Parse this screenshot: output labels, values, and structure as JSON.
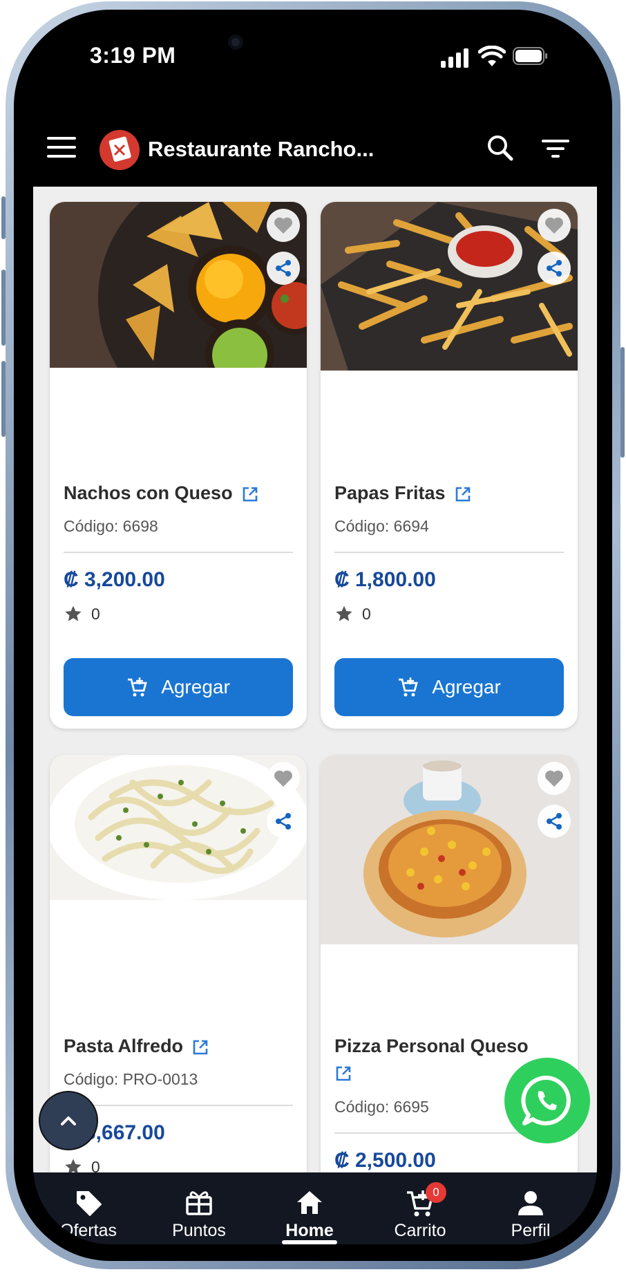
{
  "status_bar": {
    "time": "3:19 PM"
  },
  "app_bar": {
    "title": "Restaurante Rancho..."
  },
  "products": [
    {
      "name": "Nachos con Queso",
      "code": "Código: 6698",
      "price": "₡ 3,200.00",
      "rating": "0",
      "button": "Agregar"
    },
    {
      "name": "Papas Fritas",
      "code": "Código: 6694",
      "price": "₡ 1,800.00",
      "rating": "0",
      "button": "Agregar"
    },
    {
      "name": "Pasta Alfredo",
      "code": "Código: PRO-0013",
      "price": "₡ 6,667.00",
      "rating": "0"
    },
    {
      "name": "Pizza Personal Queso",
      "code": "Código: 6695",
      "price": "₡ 2,500.00"
    }
  ],
  "bottom_nav": {
    "items": [
      {
        "label": "Ofertas",
        "icon": "tag-icon"
      },
      {
        "label": "Puntos",
        "icon": "gift-icon"
      },
      {
        "label": "Home",
        "icon": "home-icon",
        "active": true
      },
      {
        "label": "Carrito",
        "icon": "cart-icon",
        "badge": "0"
      },
      {
        "label": "Perfil",
        "icon": "person-icon"
      }
    ]
  },
  "colors": {
    "primary": "#1a75d2",
    "price": "#17499a",
    "whatsapp": "#2fcf5d",
    "nav_bg": "#131722",
    "badge": "#e53935"
  }
}
